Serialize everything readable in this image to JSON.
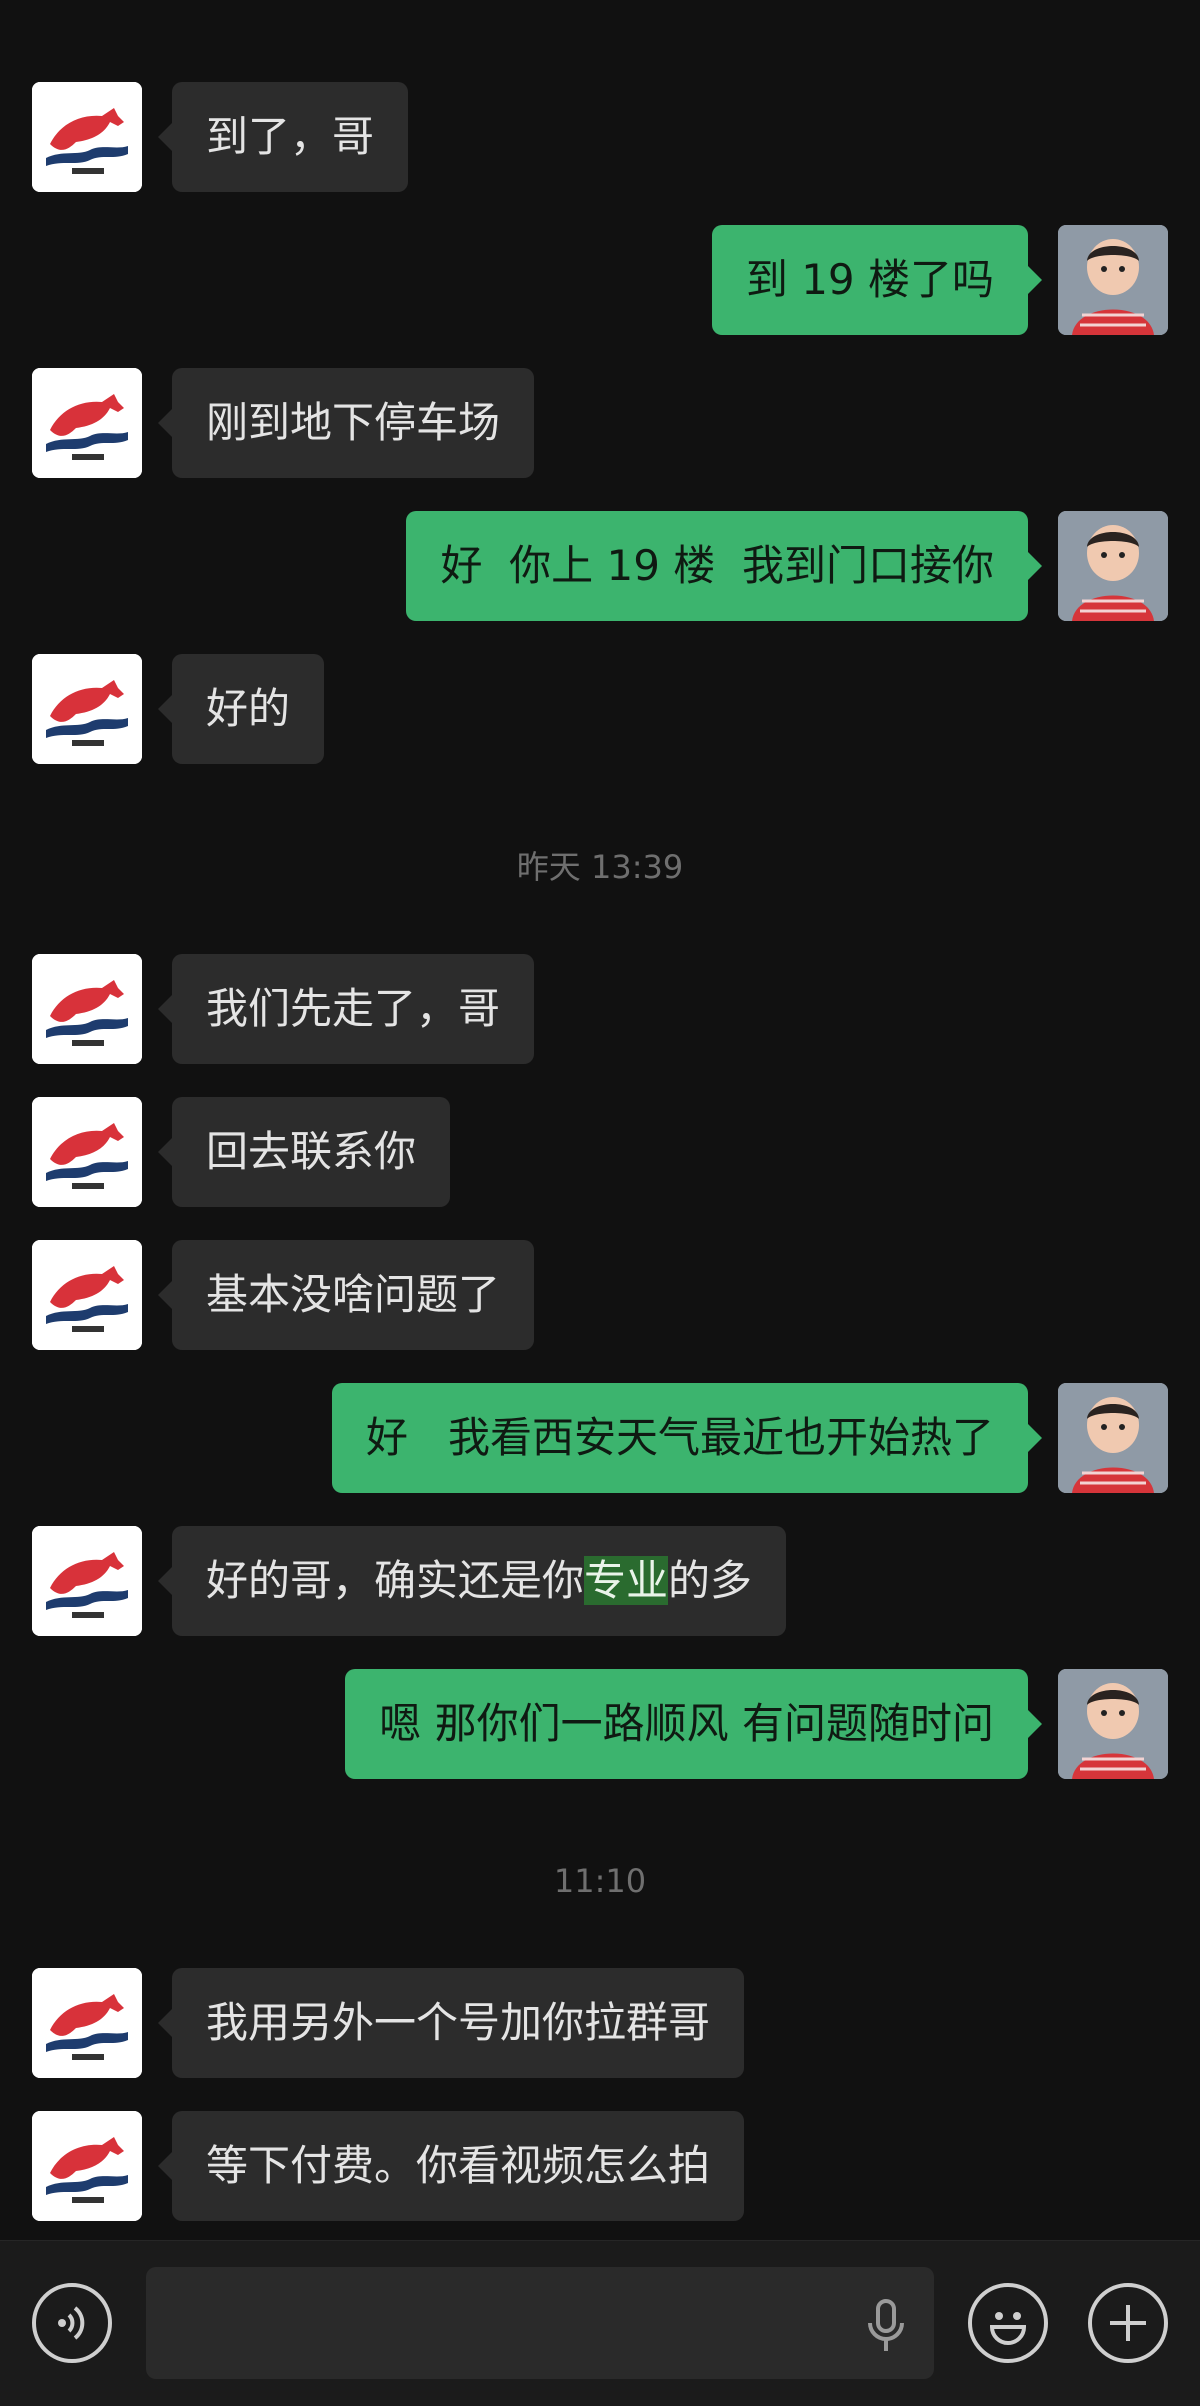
{
  "timestamps": [
    "昨天 13:39",
    "11:10"
  ],
  "messages": [
    {
      "dir": "in",
      "text": "到了，哥"
    },
    {
      "dir": "out",
      "text": "到 19 楼了吗"
    },
    {
      "dir": "in",
      "text": "刚到地下停车场"
    },
    {
      "dir": "out",
      "text": "好  你上 19 楼  我到门口接你"
    },
    {
      "dir": "in",
      "text": "好的"
    },
    {
      "dir": "in",
      "text": "我们先走了，哥"
    },
    {
      "dir": "in",
      "text": "回去联系你"
    },
    {
      "dir": "in",
      "text": "基本没啥问题了"
    },
    {
      "dir": "out",
      "text": "好   我看西安天气最近也开始热了"
    },
    {
      "dir": "in",
      "text_before": "好的哥，确实还是你",
      "text_highlight": "专业",
      "text_after": "的多"
    },
    {
      "dir": "out",
      "text": "嗯 那你们一路顺风 有问题随时问"
    },
    {
      "dir": "in",
      "text": "我用另外一个号加你拉群哥"
    },
    {
      "dir": "in",
      "text": "等下付费。你看视频怎么拍"
    }
  ],
  "input": {
    "value": ""
  },
  "colors": {
    "background": "#111111",
    "incoming_bubble": "#2c2c2c",
    "outgoing_bubble": "#3cb46e",
    "highlight": "#2a6b2f"
  },
  "icons": {
    "voice": "voice-mode-icon",
    "mic": "microphone-icon",
    "emoji": "emoji-icon",
    "plus": "plus-icon",
    "contact_avatar": "horse-logo-avatar",
    "self_avatar": "child-photo-avatar"
  }
}
